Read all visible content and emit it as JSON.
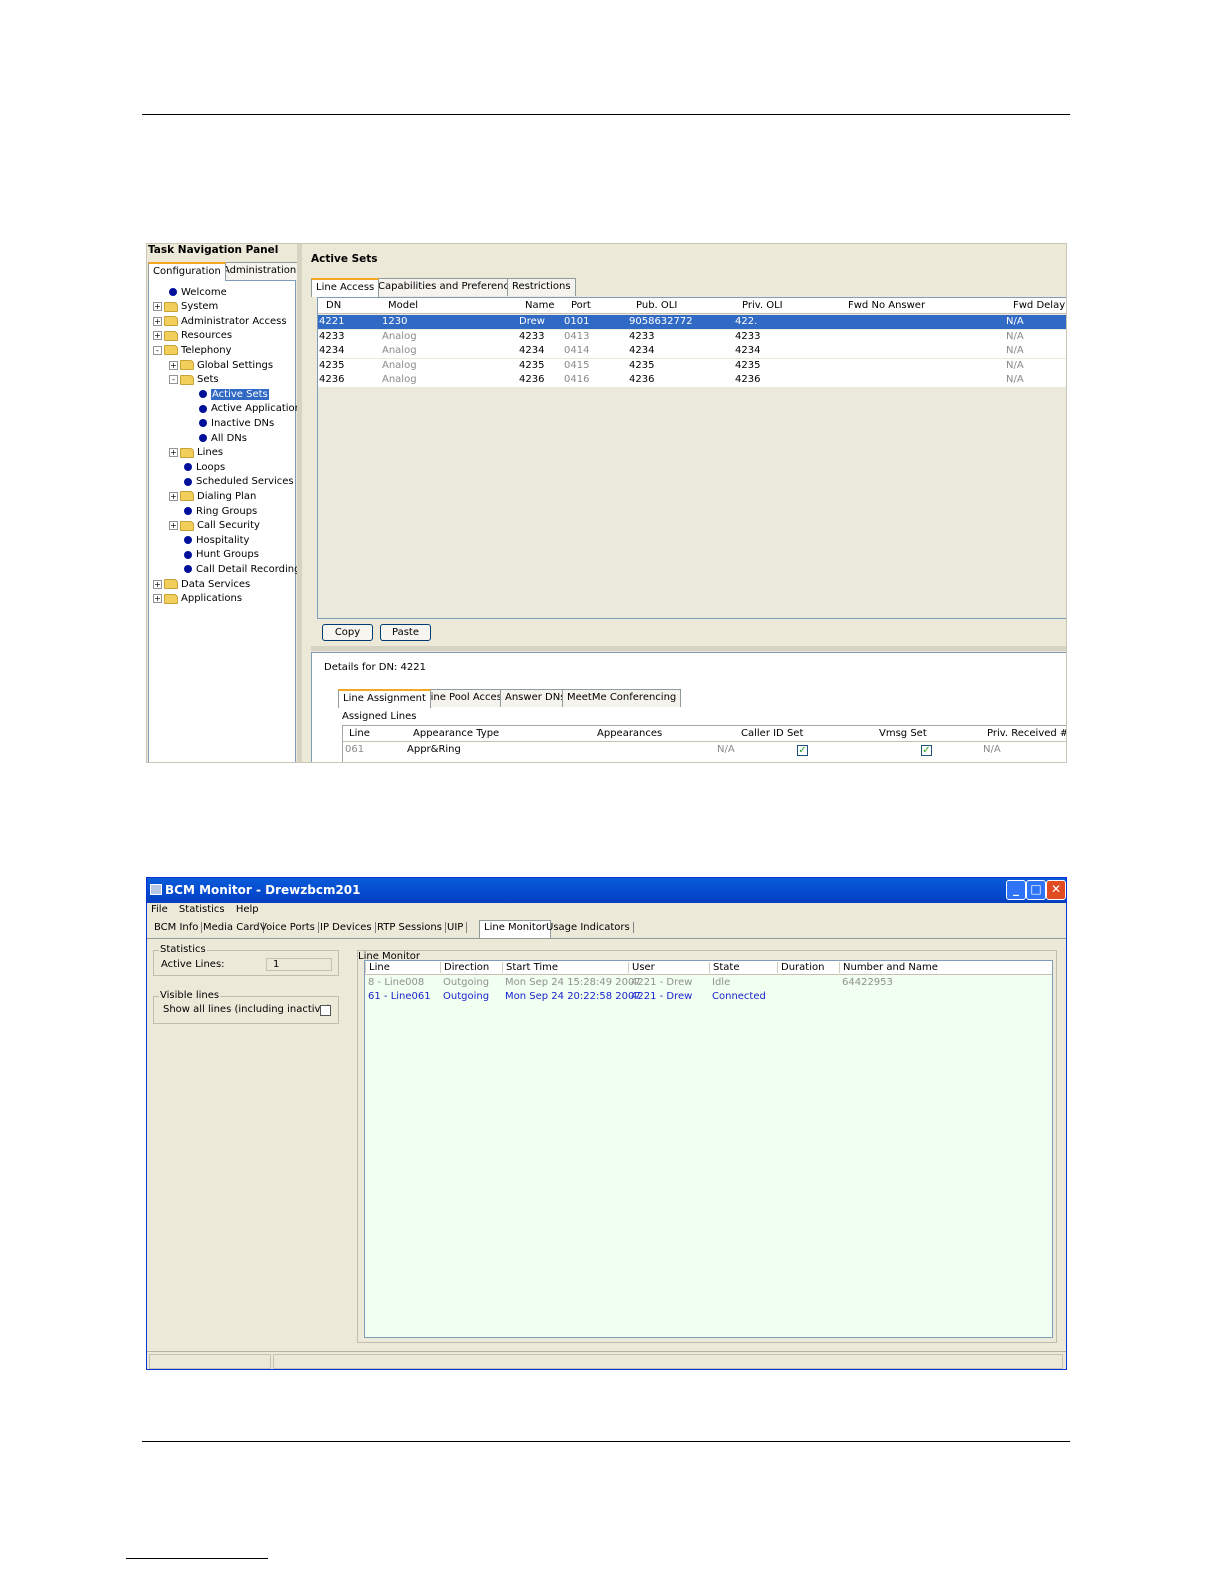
{
  "screenshot1": {
    "nav_title": "Task Navigation Panel",
    "nav_tabs": [
      "Configuration",
      "Administration"
    ],
    "tree": [
      {
        "label": "Welcome",
        "level": 1,
        "type": "leaf"
      },
      {
        "label": "System",
        "level": 0,
        "type": "folder",
        "state": "+"
      },
      {
        "label": "Administrator Access",
        "level": 0,
        "type": "folder",
        "state": "+"
      },
      {
        "label": "Resources",
        "level": 0,
        "type": "folder",
        "state": "+"
      },
      {
        "label": "Telephony",
        "level": 0,
        "type": "folder",
        "state": "-"
      },
      {
        "label": "Global Settings",
        "level": 1,
        "type": "folder",
        "state": "+"
      },
      {
        "label": "Sets",
        "level": 1,
        "type": "folder",
        "state": "-"
      },
      {
        "label": "Active Sets",
        "level": 3,
        "type": "leaf",
        "selected": true
      },
      {
        "label": "Active Application",
        "level": 3,
        "type": "leaf"
      },
      {
        "label": "Inactive DNs",
        "level": 3,
        "type": "leaf"
      },
      {
        "label": "All DNs",
        "level": 3,
        "type": "leaf"
      },
      {
        "label": "Lines",
        "level": 1,
        "type": "folder",
        "state": "+"
      },
      {
        "label": "Loops",
        "level": 2,
        "type": "leaf"
      },
      {
        "label": "Scheduled Services",
        "level": 2,
        "type": "leaf"
      },
      {
        "label": "Dialing Plan",
        "level": 1,
        "type": "folder",
        "state": "+"
      },
      {
        "label": "Ring Groups",
        "level": 2,
        "type": "leaf"
      },
      {
        "label": "Call Security",
        "level": 1,
        "type": "folder",
        "state": "+"
      },
      {
        "label": "Hospitality",
        "level": 2,
        "type": "leaf"
      },
      {
        "label": "Hunt Groups",
        "level": 2,
        "type": "leaf"
      },
      {
        "label": "Call Detail Recording",
        "level": 2,
        "type": "leaf"
      },
      {
        "label": "Data Services",
        "level": 0,
        "type": "folder",
        "state": "+"
      },
      {
        "label": "Applications",
        "level": 0,
        "type": "folder",
        "state": "+"
      }
    ],
    "main_title": "Active Sets",
    "content_tabs": [
      "Line Access",
      "Capabilities and Preferences",
      "Restrictions"
    ],
    "columns": [
      "DN",
      "Model",
      "Name",
      "Port",
      "Pub. OLI",
      "Priv. OLI",
      "Fwd No Answer",
      "Fwd Delay"
    ],
    "rows": [
      {
        "dn": "4221",
        "model": "1230",
        "name": "Drew",
        "port": "0101",
        "pub_oli": "9058632772",
        "priv_oli": "422.",
        "fwd_no_answer": "",
        "fwd_delay": "N/A",
        "selected": true
      },
      {
        "dn": "4233",
        "model": "Analog",
        "name": "4233",
        "port": "0413",
        "pub_oli": "4233",
        "priv_oli": "4233",
        "fwd_no_answer": "",
        "fwd_delay": "N/A"
      },
      {
        "dn": "4234",
        "model": "Analog",
        "name": "4234",
        "port": "0414",
        "pub_oli": "4234",
        "priv_oli": "4234",
        "fwd_no_answer": "",
        "fwd_delay": "N/A"
      },
      {
        "dn": "4235",
        "model": "Analog",
        "name": "4235",
        "port": "0415",
        "pub_oli": "4235",
        "priv_oli": "4235",
        "fwd_no_answer": "",
        "fwd_delay": "N/A"
      },
      {
        "dn": "4236",
        "model": "Analog",
        "name": "4236",
        "port": "0416",
        "pub_oli": "4236",
        "priv_oli": "4236",
        "fwd_no_answer": "",
        "fwd_delay": "N/A"
      }
    ],
    "copy_label": "Copy",
    "paste_label": "Paste",
    "details_label": "Details for DN: 4221",
    "detail_tabs": [
      "Line Assignment",
      "Line Pool Access",
      "Answer DNs",
      "MeetMe Conferencing"
    ],
    "assigned_lines_label": "Assigned Lines",
    "assigned_columns": [
      "Line",
      "Appearance Type",
      "Appearances",
      "Caller ID Set",
      "Vmsg Set",
      "Priv. Received #"
    ],
    "assigned_row": {
      "line": "061",
      "appearance_type": "Appr&Ring",
      "appearances": "N/A",
      "caller_id_set": true,
      "vmsg_set": true,
      "priv_received": "N/A"
    }
  },
  "screenshot2": {
    "window_title": "BCM Monitor - Drewzbcm201",
    "menu": [
      "File",
      "Statistics",
      "Help"
    ],
    "tabs": [
      "BCM Info",
      "Media Card",
      "Voice Ports",
      "IP Devices",
      "RTP Sessions",
      "UIP",
      "Line Monitor",
      "Usage Indicators"
    ],
    "active_tab": "Line Monitor",
    "statistics_title": "Statistics",
    "active_lines_label": "Active Lines:",
    "active_lines_value": "1",
    "visible_lines_title": "Visible lines",
    "show_all_label": "Show all lines (including inactive)",
    "line_monitor_title": "Line Monitor",
    "columns": [
      "Line",
      "Direction",
      "Start Time",
      "User",
      "State",
      "Duration",
      "Number and Name"
    ],
    "rows": [
      {
        "line": "8 - Line008",
        "direction": "Outgoing",
        "start_time": "Mon Sep 24 15:28:49 2007",
        "user": "4221 - Drew",
        "state": "Idle",
        "duration": "",
        "number": "64422953"
      },
      {
        "line": "61 - Line061",
        "direction": "Outgoing",
        "start_time": "Mon Sep 24 20:22:58 2007",
        "user": "4221 - Drew",
        "state": "Connected",
        "duration": "",
        "number": ""
      }
    ]
  }
}
